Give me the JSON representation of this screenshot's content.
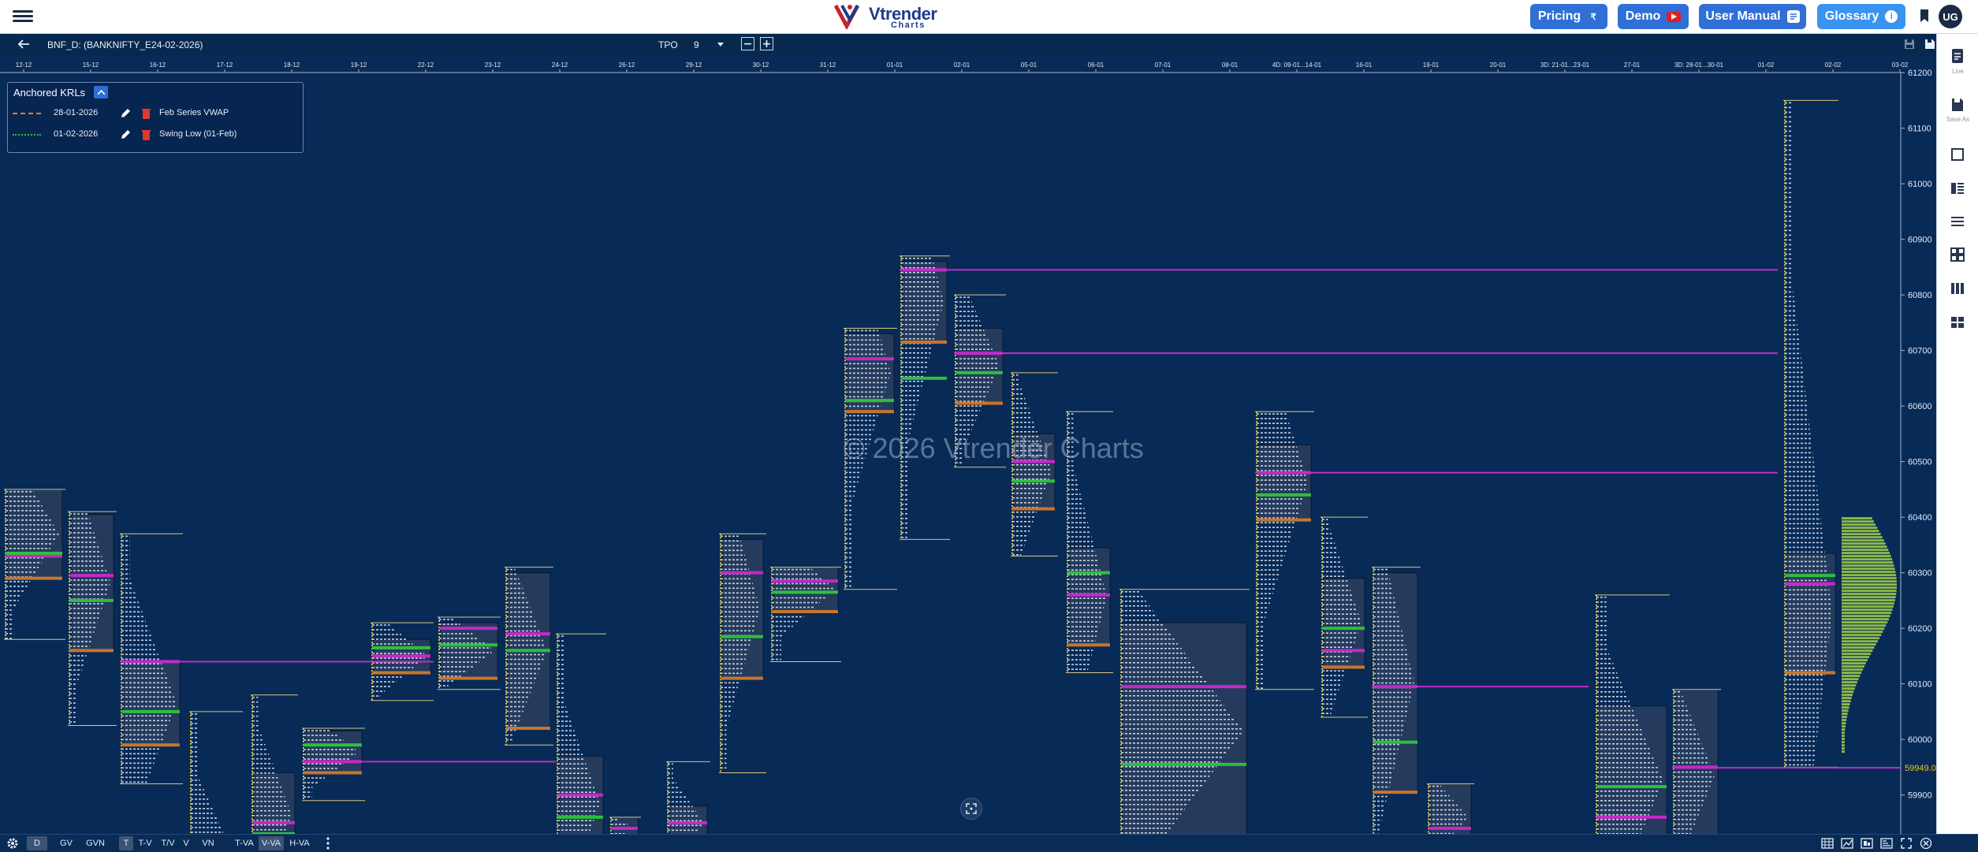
{
  "header": {
    "logo_text": "Vtrender",
    "logo_sub": "Charts",
    "buttons": {
      "pricing": "Pricing",
      "demo": "Demo",
      "manual": "User Manual",
      "glossary": "Glossary"
    },
    "avatar": "UG"
  },
  "toolbar": {
    "symbol": "BNF_D: (BANKNIFTY_E24-02-2026)",
    "tpo_label": "TPO",
    "tpo_value": "9"
  },
  "krl": {
    "title": "Anchored KRLs",
    "rows": [
      {
        "date": "28-01-2026",
        "name": "Feb Series VWAP",
        "color": "#f07e2c"
      },
      {
        "date": "01-02-2026",
        "name": "Swing Low (01-Feb)",
        "color": "#2dbf3c"
      }
    ]
  },
  "watermark": "© 2026 Vtrender Charts",
  "right_panel": {
    "live": "Live",
    "save_as": "Save As"
  },
  "bottom_tabs": [
    "D",
    "GV",
    "GVN",
    "T",
    "T-V",
    "T/V",
    "V",
    "VN",
    "T-VA",
    "V-VA",
    "H-VA"
  ],
  "selected_tabs": [
    "D",
    "T",
    "V-VA"
  ],
  "chart_data": {
    "type": "market-profile",
    "date_labels": [
      "12-12",
      "15-12",
      "16-12",
      "17-12",
      "18-12",
      "19-12",
      "22-12",
      "23-12",
      "24-12",
      "26-12",
      "29-12",
      "30-12",
      "31-12",
      "01-01",
      "02-01",
      "05-01",
      "06-01",
      "07-01",
      "08-01",
      "4D: 09-01...14-01",
      "16-01",
      "19-01",
      "20-01",
      "3D: 21-01...23-01",
      "27-01",
      "3D: 28-01...30-01",
      "01-02",
      "02-02",
      "03-02"
    ],
    "price_ticks": [
      61200,
      61100,
      61000,
      60900,
      60800,
      60700,
      60600,
      60500,
      60400,
      60300,
      60200,
      60100,
      60000,
      59900
    ],
    "ylim": [
      59830,
      61230
    ],
    "current_price_label": "59949.00",
    "current_price": 59949,
    "colors": {
      "background": "#072a57",
      "poc": "#c429c8",
      "vah": "#2dbf3c",
      "val": "#c8752b",
      "tpo": "#e6ecf5",
      "price_tag": "#f0c419"
    },
    "profiles": [
      {
        "x": 5,
        "w": 78,
        "high": 60450,
        "low": 60180,
        "va_hi": 60450,
        "va_lo": 60290,
        "poc": 60330,
        "green": 60335
      },
      {
        "x": 86,
        "w": 62,
        "high": 60410,
        "low": 60025,
        "va_hi": 60405,
        "va_lo": 60160,
        "poc": 60295,
        "green": 60250
      },
      {
        "x": 152,
        "w": 80,
        "high": 60370,
        "low": 59920,
        "va_hi": 60140,
        "va_lo": 59990,
        "poc": 60140,
        "green": 60050
      },
      {
        "x": 240,
        "w": 68,
        "high": 60050,
        "low": 59740,
        "va_hi": 59830,
        "va_lo": 59730,
        "poc": 59770,
        "green": 59790
      },
      {
        "x": 318,
        "w": 60,
        "high": 60080,
        "low": 59760,
        "va_hi": 59940,
        "va_lo": 59790,
        "poc": 59850,
        "green": 59830
      },
      {
        "x": 383,
        "w": 80,
        "high": 60020,
        "low": 59890,
        "va_hi": 60015,
        "va_lo": 59940,
        "poc": 59960,
        "green": 59990
      },
      {
        "x": 470,
        "w": 80,
        "high": 60210,
        "low": 60070,
        "va_hi": 60180,
        "va_lo": 60120,
        "poc": 60150,
        "green": 60165
      },
      {
        "x": 555,
        "w": 80,
        "high": 60220,
        "low": 60090,
        "va_hi": 60210,
        "va_lo": 60110,
        "poc": 60200,
        "green": 60170
      },
      {
        "x": 640,
        "w": 62,
        "high": 60310,
        "low": 59990,
        "va_hi": 60300,
        "va_lo": 60020,
        "poc": 60190,
        "green": 60160
      },
      {
        "x": 705,
        "w": 64,
        "high": 60190,
        "low": 59820,
        "va_hi": 59970,
        "va_lo": 59800,
        "poc": 59900,
        "green": 59860
      },
      {
        "x": 773,
        "w": 40,
        "high": 59860,
        "low": 59820,
        "va_hi": 59860,
        "va_lo": 59820,
        "poc": 59840,
        "green": 0
      },
      {
        "x": 845,
        "w": 56,
        "high": 59960,
        "low": 59800,
        "va_hi": 59880,
        "va_lo": 59820,
        "poc": 59850,
        "green": 0
      },
      {
        "x": 912,
        "w": 60,
        "high": 60370,
        "low": 59940,
        "va_hi": 60360,
        "va_lo": 60110,
        "poc": 60300,
        "green": 60185
      },
      {
        "x": 977,
        "w": 90,
        "high": 60310,
        "low": 60140,
        "va_hi": 60310,
        "va_lo": 60230,
        "poc": 60285,
        "green": 60265
      },
      {
        "x": 1070,
        "w": 68,
        "high": 60740,
        "low": 60270,
        "va_hi": 60730,
        "va_lo": 60590,
        "poc": 60685,
        "green": 60610
      },
      {
        "x": 1141,
        "w": 64,
        "high": 60870,
        "low": 60360,
        "va_hi": 60860,
        "va_lo": 60715,
        "poc": 60845,
        "green": 60650
      },
      {
        "x": 1210,
        "w": 66,
        "high": 60800,
        "low": 60490,
        "va_hi": 60740,
        "va_lo": 60605,
        "poc": 60695,
        "green": 60660
      },
      {
        "x": 1282,
        "w": 60,
        "high": 60660,
        "low": 60330,
        "va_hi": 60550,
        "va_lo": 60415,
        "poc": 60500,
        "green": 60465
      },
      {
        "x": 1352,
        "w": 60,
        "high": 60590,
        "low": 60120,
        "va_hi": 60345,
        "va_lo": 60170,
        "poc": 60260,
        "green": 60300
      },
      {
        "x": 1420,
        "w": 165,
        "high": 60270,
        "low": 59770,
        "va_hi": 60210,
        "va_lo": 59820,
        "poc": 60095,
        "green": 59955
      },
      {
        "x": 1592,
        "w": 75,
        "high": 60590,
        "low": 60090,
        "va_hi": 60530,
        "va_lo": 60395,
        "poc": 60480,
        "green": 60440
      },
      {
        "x": 1675,
        "w": 60,
        "high": 60400,
        "low": 60040,
        "va_hi": 60290,
        "va_lo": 60130,
        "poc": 60160,
        "green": 60200
      },
      {
        "x": 1740,
        "w": 62,
        "high": 60310,
        "low": 59780,
        "va_hi": 60300,
        "va_lo": 59905,
        "poc": 60095,
        "green": 59995
      },
      {
        "x": 1810,
        "w": 60,
        "high": 59920,
        "low": 59780,
        "va_hi": 59920,
        "va_lo": 59800,
        "poc": 59840,
        "green": 0
      },
      {
        "x": 2023,
        "w": 95,
        "high": 60260,
        "low": 59780,
        "va_hi": 60060,
        "va_lo": 59790,
        "poc": 59860,
        "green": 59915
      },
      {
        "x": 2121,
        "w": 62,
        "high": 60090,
        "low": 59780,
        "va_hi": 60090,
        "va_lo": 59780,
        "poc": 59950,
        "green": 0
      },
      {
        "x": 2262,
        "w": 70,
        "high": 61150,
        "low": 59950,
        "va_hi": 60335,
        "va_lo": 60120,
        "poc": 60280,
        "green": 60295
      }
    ],
    "naked_pocs": [
      {
        "price": 60845,
        "x1": 1141,
        "x2": 2255
      },
      {
        "price": 60695,
        "x1": 1210,
        "x2": 2255
      },
      {
        "price": 60480,
        "x1": 1592,
        "x2": 2255
      },
      {
        "price": 60140,
        "x1": 152,
        "x2": 550
      },
      {
        "price": 60095,
        "x1": 1740,
        "x2": 2015
      },
      {
        "price": 59960,
        "x1": 383,
        "x2": 705
      },
      {
        "price": 59949,
        "x1": 2121,
        "x2": 2410
      }
    ]
  }
}
